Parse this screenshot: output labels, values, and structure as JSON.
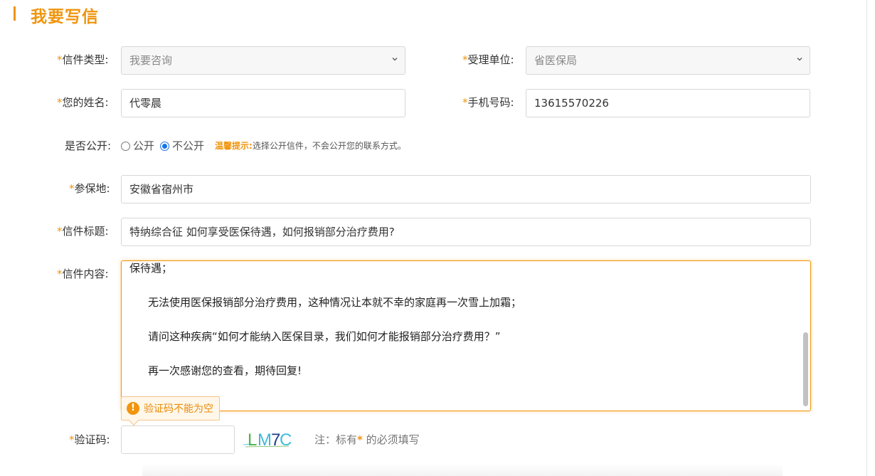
{
  "page_title": "我要写信",
  "required_mark": "*",
  "letter_type": {
    "label": "信件类型:",
    "value": "我要咨询"
  },
  "unit": {
    "label": "受理单位:",
    "value": "省医保局"
  },
  "name": {
    "label": "您的姓名:",
    "value": "代零晨"
  },
  "phone": {
    "label": "手机号码:",
    "value": "13615570226"
  },
  "public": {
    "label": "是否公开:",
    "options": [
      "公开",
      "不公开"
    ],
    "selected": "不公开",
    "tip_label": "温馨提示:",
    "tip_text": "选择公开信件，不会公开您的联系方式。"
  },
  "insured_place": {
    "label": "参保地:",
    "value": "安徽省宿州市"
  },
  "subject": {
    "label": "信件标题:",
    "value": "特纳综合征 如何享受医保待遇，如何报销部分治疗费用?"
  },
  "content": {
    "label": "信件内容:",
    "lines": [
      "保待遇；",
      "无法使用医保报销部分治疗费用，这种情况让本就不幸的家庭再一次雪上加霜；",
      "请问这种疾病“如何才能纳入医保目录，我们如何才能报销部分治疗费用？”",
      "再一次感谢您的查看，期待回复!"
    ]
  },
  "captcha": {
    "label": "验证码:",
    "value": "",
    "image_text": "LM7C",
    "error": "验证码不能为空",
    "note_prefix": "注：标有",
    "note_suffix": " 的必须填写"
  },
  "colors": {
    "accent": "#f0950d",
    "radio_checked": "#1a73e8"
  }
}
